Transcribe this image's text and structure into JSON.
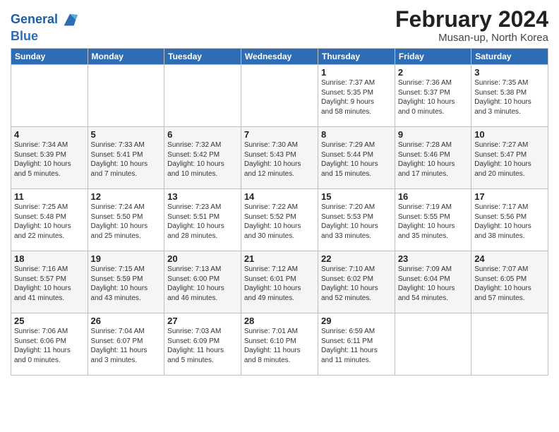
{
  "logo": {
    "line1": "General",
    "line2": "Blue"
  },
  "title": "February 2024",
  "subtitle": "Musan-up, North Korea",
  "days_of_week": [
    "Sunday",
    "Monday",
    "Tuesday",
    "Wednesday",
    "Thursday",
    "Friday",
    "Saturday"
  ],
  "weeks": [
    [
      {
        "day": "",
        "info": ""
      },
      {
        "day": "",
        "info": ""
      },
      {
        "day": "",
        "info": ""
      },
      {
        "day": "",
        "info": ""
      },
      {
        "day": "1",
        "info": "Sunrise: 7:37 AM\nSunset: 5:35 PM\nDaylight: 9 hours\nand 58 minutes."
      },
      {
        "day": "2",
        "info": "Sunrise: 7:36 AM\nSunset: 5:37 PM\nDaylight: 10 hours\nand 0 minutes."
      },
      {
        "day": "3",
        "info": "Sunrise: 7:35 AM\nSunset: 5:38 PM\nDaylight: 10 hours\nand 3 minutes."
      }
    ],
    [
      {
        "day": "4",
        "info": "Sunrise: 7:34 AM\nSunset: 5:39 PM\nDaylight: 10 hours\nand 5 minutes."
      },
      {
        "day": "5",
        "info": "Sunrise: 7:33 AM\nSunset: 5:41 PM\nDaylight: 10 hours\nand 7 minutes."
      },
      {
        "day": "6",
        "info": "Sunrise: 7:32 AM\nSunset: 5:42 PM\nDaylight: 10 hours\nand 10 minutes."
      },
      {
        "day": "7",
        "info": "Sunrise: 7:30 AM\nSunset: 5:43 PM\nDaylight: 10 hours\nand 12 minutes."
      },
      {
        "day": "8",
        "info": "Sunrise: 7:29 AM\nSunset: 5:44 PM\nDaylight: 10 hours\nand 15 minutes."
      },
      {
        "day": "9",
        "info": "Sunrise: 7:28 AM\nSunset: 5:46 PM\nDaylight: 10 hours\nand 17 minutes."
      },
      {
        "day": "10",
        "info": "Sunrise: 7:27 AM\nSunset: 5:47 PM\nDaylight: 10 hours\nand 20 minutes."
      }
    ],
    [
      {
        "day": "11",
        "info": "Sunrise: 7:25 AM\nSunset: 5:48 PM\nDaylight: 10 hours\nand 22 minutes."
      },
      {
        "day": "12",
        "info": "Sunrise: 7:24 AM\nSunset: 5:50 PM\nDaylight: 10 hours\nand 25 minutes."
      },
      {
        "day": "13",
        "info": "Sunrise: 7:23 AM\nSunset: 5:51 PM\nDaylight: 10 hours\nand 28 minutes."
      },
      {
        "day": "14",
        "info": "Sunrise: 7:22 AM\nSunset: 5:52 PM\nDaylight: 10 hours\nand 30 minutes."
      },
      {
        "day": "15",
        "info": "Sunrise: 7:20 AM\nSunset: 5:53 PM\nDaylight: 10 hours\nand 33 minutes."
      },
      {
        "day": "16",
        "info": "Sunrise: 7:19 AM\nSunset: 5:55 PM\nDaylight: 10 hours\nand 35 minutes."
      },
      {
        "day": "17",
        "info": "Sunrise: 7:17 AM\nSunset: 5:56 PM\nDaylight: 10 hours\nand 38 minutes."
      }
    ],
    [
      {
        "day": "18",
        "info": "Sunrise: 7:16 AM\nSunset: 5:57 PM\nDaylight: 10 hours\nand 41 minutes."
      },
      {
        "day": "19",
        "info": "Sunrise: 7:15 AM\nSunset: 5:59 PM\nDaylight: 10 hours\nand 43 minutes."
      },
      {
        "day": "20",
        "info": "Sunrise: 7:13 AM\nSunset: 6:00 PM\nDaylight: 10 hours\nand 46 minutes."
      },
      {
        "day": "21",
        "info": "Sunrise: 7:12 AM\nSunset: 6:01 PM\nDaylight: 10 hours\nand 49 minutes."
      },
      {
        "day": "22",
        "info": "Sunrise: 7:10 AM\nSunset: 6:02 PM\nDaylight: 10 hours\nand 52 minutes."
      },
      {
        "day": "23",
        "info": "Sunrise: 7:09 AM\nSunset: 6:04 PM\nDaylight: 10 hours\nand 54 minutes."
      },
      {
        "day": "24",
        "info": "Sunrise: 7:07 AM\nSunset: 6:05 PM\nDaylight: 10 hours\nand 57 minutes."
      }
    ],
    [
      {
        "day": "25",
        "info": "Sunrise: 7:06 AM\nSunset: 6:06 PM\nDaylight: 11 hours\nand 0 minutes."
      },
      {
        "day": "26",
        "info": "Sunrise: 7:04 AM\nSunset: 6:07 PM\nDaylight: 11 hours\nand 3 minutes."
      },
      {
        "day": "27",
        "info": "Sunrise: 7:03 AM\nSunset: 6:09 PM\nDaylight: 11 hours\nand 5 minutes."
      },
      {
        "day": "28",
        "info": "Sunrise: 7:01 AM\nSunset: 6:10 PM\nDaylight: 11 hours\nand 8 minutes."
      },
      {
        "day": "29",
        "info": "Sunrise: 6:59 AM\nSunset: 6:11 PM\nDaylight: 11 hours\nand 11 minutes."
      },
      {
        "day": "",
        "info": ""
      },
      {
        "day": "",
        "info": ""
      }
    ]
  ]
}
